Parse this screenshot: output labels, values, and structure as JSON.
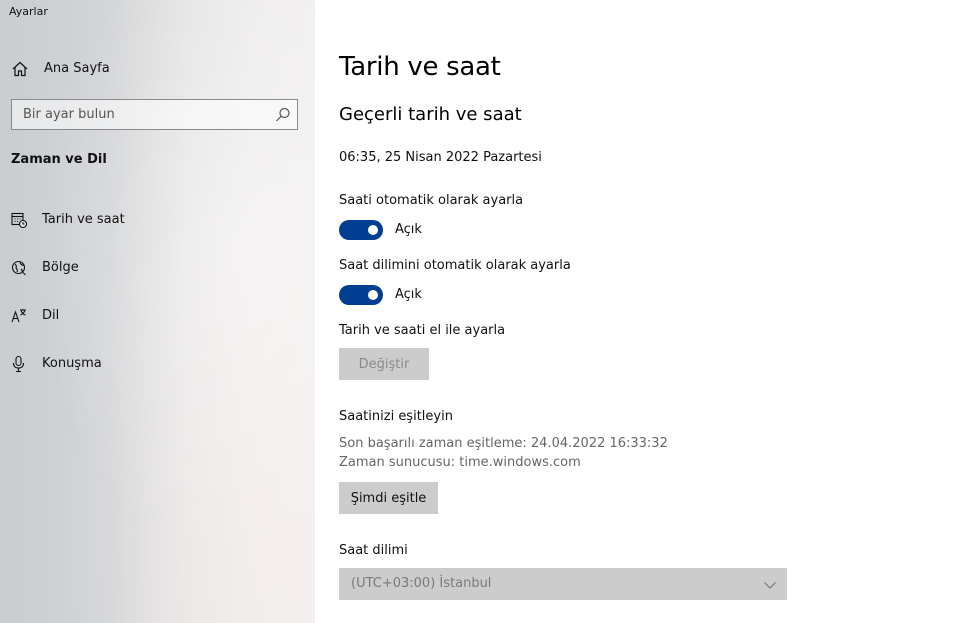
{
  "window": {
    "title": "Ayarlar"
  },
  "sidebar": {
    "home_label": "Ana Sayfa",
    "search": {
      "placeholder": "Bir ayar bulun",
      "value": ""
    },
    "group_title": "Zaman ve Dil",
    "items": [
      {
        "label": "Tarih ve saat",
        "icon": "calendar-clock-icon"
      },
      {
        "label": "Bölge",
        "icon": "globe-icon"
      },
      {
        "label": "Dil",
        "icon": "language-icon"
      },
      {
        "label": "Konuşma",
        "icon": "microphone-icon"
      }
    ]
  },
  "main": {
    "title": "Tarih ve saat",
    "current": {
      "heading": "Geçerli tarih ve saat",
      "value": "06:35, 25 Nisan 2022 Pazartesi"
    },
    "auto_time": {
      "label": "Saati otomatik olarak ayarla",
      "state": "Açık",
      "on": true
    },
    "auto_timezone": {
      "label": "Saat dilimini otomatik olarak ayarla",
      "state": "Açık",
      "on": true
    },
    "manual": {
      "label": "Tarih ve saati el ile ayarla",
      "button": "Değiştir"
    },
    "sync": {
      "heading": "Saatinizi eşitleyin",
      "last_sync": "Son başarılı zaman eşitleme:  24.04.2022 16:33:32",
      "server": "Zaman sunucusu:  time.windows.com",
      "button": "Şimdi eşitle"
    },
    "timezone": {
      "label": "Saat dilimi",
      "selected": "(UTC+03:00) İstanbul"
    }
  },
  "colors": {
    "accent": "#003e92",
    "button_bg": "#cccccc",
    "disabled_text": "#8a8a8a"
  }
}
